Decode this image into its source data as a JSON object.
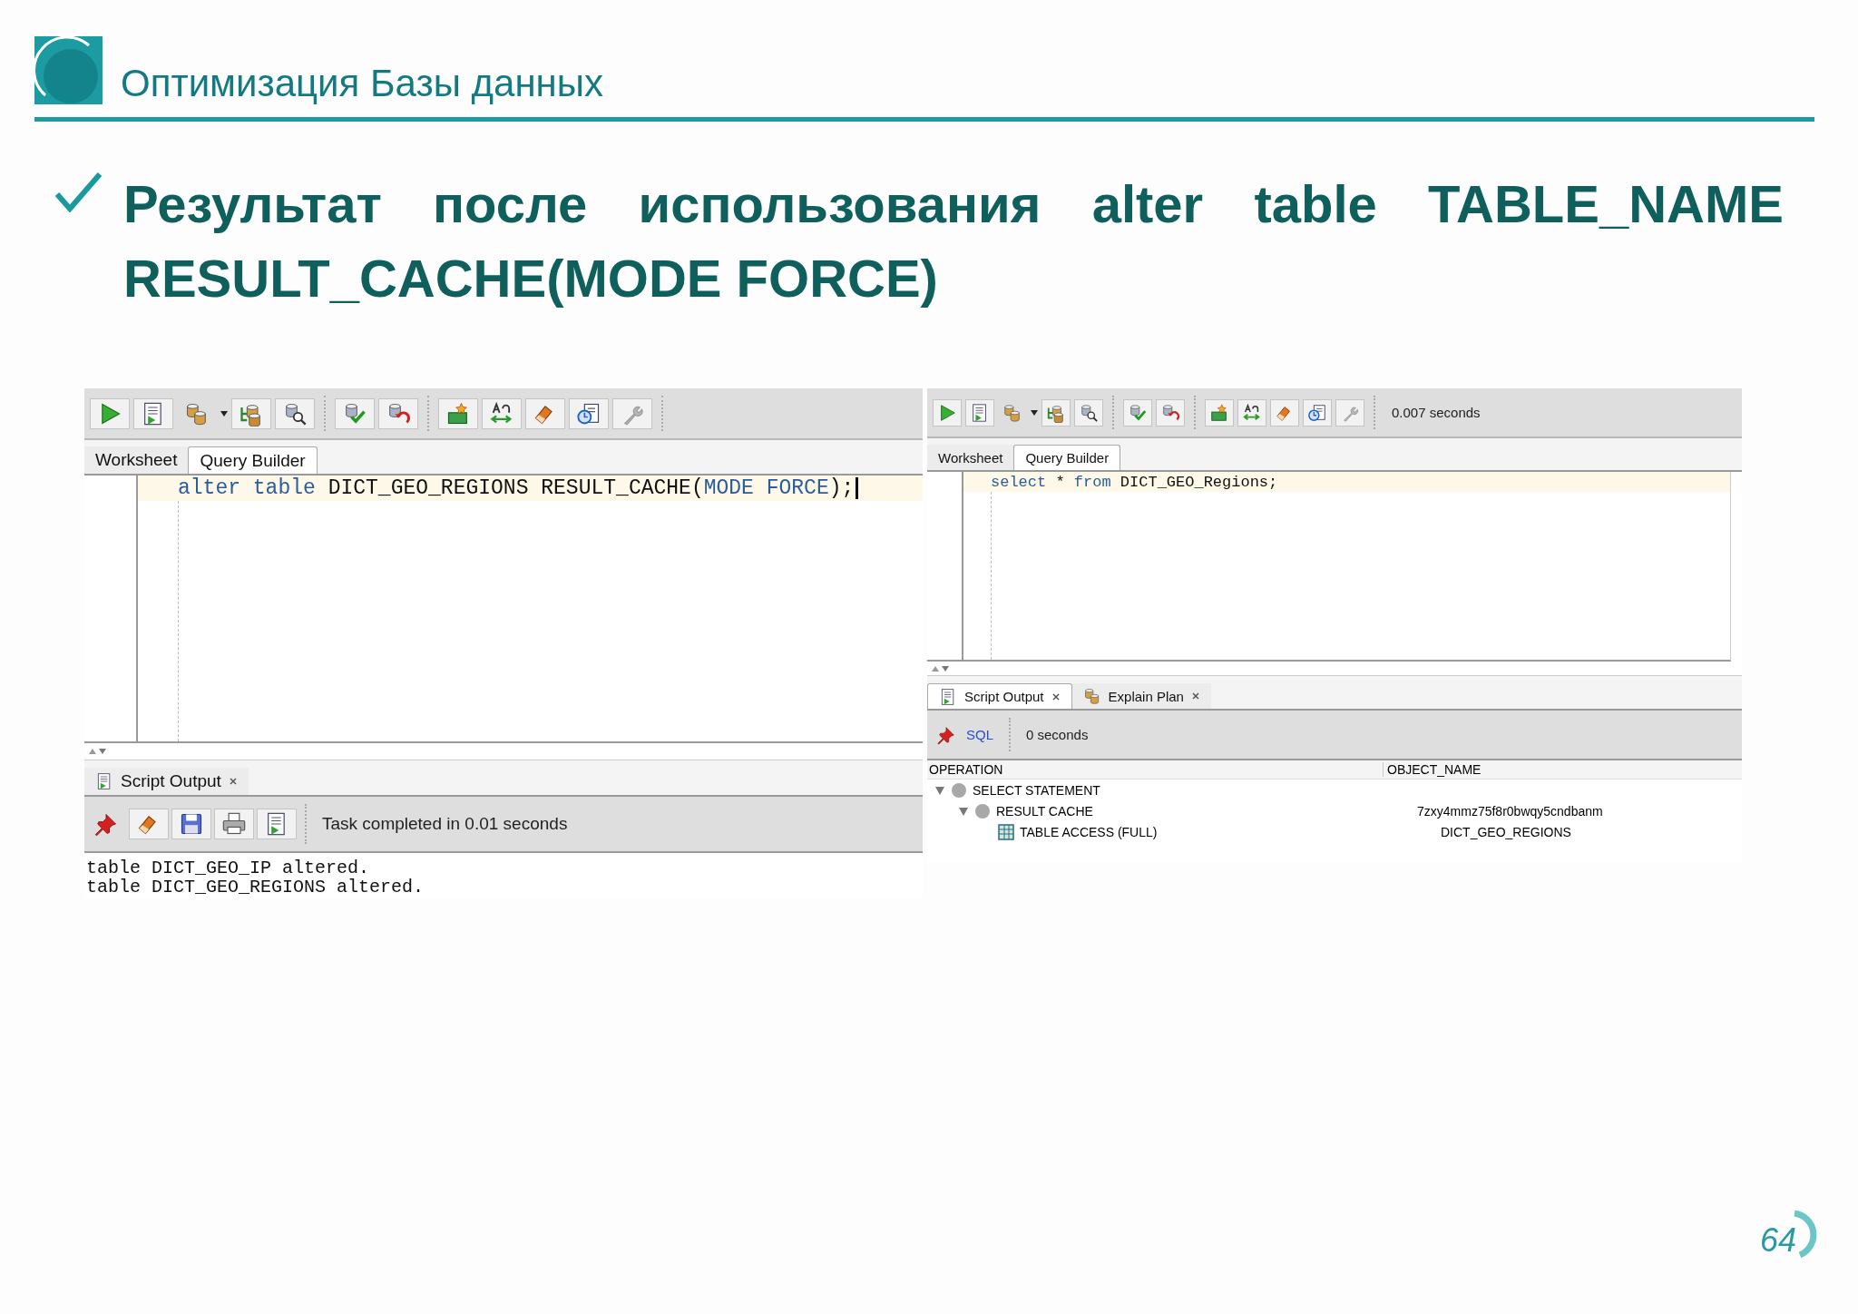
{
  "header": {
    "title": "Оптимизация Базы данных"
  },
  "heading": "Результат после использования alter table TABLE_NAME RESULT_CACHE(MODE FORCE)",
  "windows": [
    {
      "tabs": [
        {
          "label": "Worksheet",
          "selected": true
        },
        {
          "label": "Query Builder",
          "selected": false
        }
      ],
      "editor": {
        "caret": true,
        "code": [
          {
            "text": "alter table",
            "kind": "keyword"
          },
          {
            "text": " DICT_GEO_REGIONS RESULT_CACHE(",
            "kind": "plain"
          },
          {
            "text": "MODE FORCE",
            "kind": "keyword"
          },
          {
            "text": ");",
            "kind": "plain"
          }
        ]
      },
      "output": {
        "kind": "script",
        "tabs": [
          {
            "label": "Script Output",
            "selected": true
          }
        ],
        "status": "Task completed in 0.01 seconds",
        "lines": [
          "table DICT_GEO_IP altered.",
          "table DICT_GEO_REGIONS altered."
        ]
      }
    },
    {
      "toolbar_status": "0.007 seconds",
      "tabs": [
        {
          "label": "Worksheet",
          "selected": true
        },
        {
          "label": "Query Builder",
          "selected": false
        }
      ],
      "editor": {
        "caret": false,
        "code": [
          {
            "text": "select",
            "kind": "keyword"
          },
          {
            "text": " * ",
            "kind": "plain"
          },
          {
            "text": "from",
            "kind": "keyword"
          },
          {
            "text": " DICT_GEO_Regions;",
            "kind": "plain"
          }
        ]
      },
      "output": {
        "kind": "plan",
        "tabs": [
          {
            "label": "Script Output",
            "selected": false
          },
          {
            "label": "Explain Plan",
            "selected": true
          }
        ],
        "link": "SQL",
        "status": "0 seconds",
        "plan": {
          "columns": [
            "OPERATION",
            "OBJECT_NAME"
          ],
          "rows": [
            {
              "kind": "operation",
              "operation": "SELECT STATEMENT",
              "expanded": true,
              "children": [
                {
                  "kind": "operation",
                  "operation": "RESULT CACHE",
                  "object": "7zxy4mmz75f8r0bwqy5cndbanm",
                  "expanded": true,
                  "children": [
                    {
                      "kind": "table",
                      "operation": "TABLE ACCESS (FULL)",
                      "object": "DICT_GEO_REGIONS"
                    }
                  ]
                }
              ]
            }
          ]
        }
      }
    }
  ],
  "page_number": "64"
}
